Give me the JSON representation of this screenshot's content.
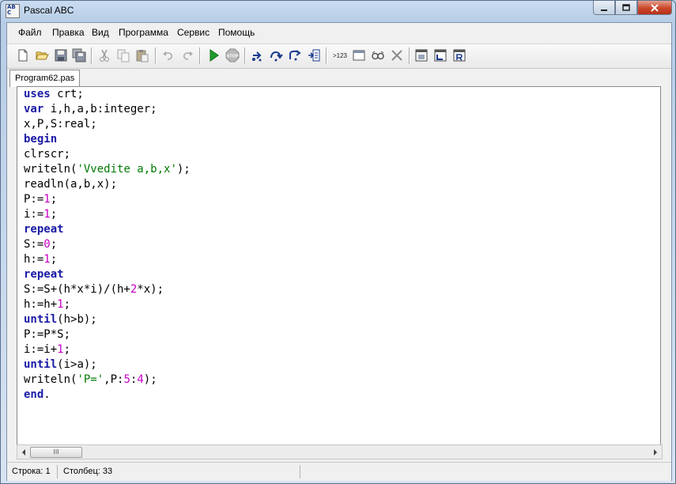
{
  "window": {
    "title": "Pascal ABC",
    "icon_letters": [
      "AB",
      "C"
    ],
    "controls": [
      "minimize-icon",
      "maximize-icon",
      "close-icon"
    ]
  },
  "menu": [
    "Файл",
    "Правка",
    "Вид",
    "Программа",
    "Сервис",
    "Помощь"
  ],
  "toolbar": {
    "buttons": [
      "new-file-icon",
      "open-folder-icon",
      "save-icon",
      "save-all-icon",
      "cut-icon",
      "copy-icon",
      "paste-icon",
      "undo-icon",
      "redo-icon",
      "run-icon",
      "stop-icon",
      "step-into-icon",
      "step-over-icon",
      "step-out-icon",
      "run-to-cursor-icon",
      "evaluate-icon",
      "output-window-icon",
      "watch-icon",
      "clear-breakpoints-icon",
      "debug-window-icon",
      "locals-window-icon",
      "errors-window-icon"
    ],
    "evaluate_label": ">123"
  },
  "tabs": [
    {
      "label": "Program62.pas",
      "active": true
    }
  ],
  "editor": {
    "lines": [
      [
        {
          "t": "uses",
          "k": "kw"
        },
        {
          "t": " crt;"
        }
      ],
      [
        {
          "t": "var",
          "k": "kw"
        },
        {
          "t": " i,h,a,b:integer;"
        }
      ],
      [
        {
          "t": "x,P,S:real;"
        }
      ],
      [
        {
          "t": "begin",
          "k": "kw"
        }
      ],
      [
        {
          "t": "clrscr;"
        }
      ],
      [
        {
          "t": "writeln("
        },
        {
          "t": "'Vvedite a,b,x'",
          "k": "str"
        },
        {
          "t": ");"
        }
      ],
      [
        {
          "t": "readln(a,b,x);"
        }
      ],
      [
        {
          "t": "P:="
        },
        {
          "t": "1",
          "k": "num"
        },
        {
          "t": ";"
        }
      ],
      [
        {
          "t": "i:="
        },
        {
          "t": "1",
          "k": "num"
        },
        {
          "t": ";"
        }
      ],
      [
        {
          "t": "repeat",
          "k": "kw"
        }
      ],
      [
        {
          "t": "S:="
        },
        {
          "t": "0",
          "k": "num"
        },
        {
          "t": ";"
        }
      ],
      [
        {
          "t": "h:="
        },
        {
          "t": "1",
          "k": "num"
        },
        {
          "t": ";"
        }
      ],
      [
        {
          "t": "repeat",
          "k": "kw"
        }
      ],
      [
        {
          "t": "S:=S+(h*x*i)/(h+"
        },
        {
          "t": "2",
          "k": "num"
        },
        {
          "t": "*x);"
        }
      ],
      [
        {
          "t": "h:=h+"
        },
        {
          "t": "1",
          "k": "num"
        },
        {
          "t": ";"
        }
      ],
      [
        {
          "t": "until",
          "k": "kw"
        },
        {
          "t": "(h>b);"
        }
      ],
      [
        {
          "t": "P:=P*S;"
        }
      ],
      [
        {
          "t": "i:=i+"
        },
        {
          "t": "1",
          "k": "num"
        },
        {
          "t": ";"
        }
      ],
      [
        {
          "t": "until",
          "k": "kw"
        },
        {
          "t": "(i>a);"
        }
      ],
      [
        {
          "t": "writeln("
        },
        {
          "t": "'P='",
          "k": "str"
        },
        {
          "t": ",P:"
        },
        {
          "t": "5",
          "k": "num"
        },
        {
          "t": ":"
        },
        {
          "t": "4",
          "k": "num"
        },
        {
          "t": ");"
        }
      ],
      [
        {
          "t": "end",
          "k": "kw"
        },
        {
          "t": "."
        }
      ]
    ]
  },
  "scrollbar": {
    "thumb_grip": "III"
  },
  "status": {
    "line": "Строка: 1",
    "column": "Столбец: 33"
  },
  "colors": {
    "keyword": "#1a1aa6",
    "number": "#c800c8",
    "string": "#007a00"
  }
}
